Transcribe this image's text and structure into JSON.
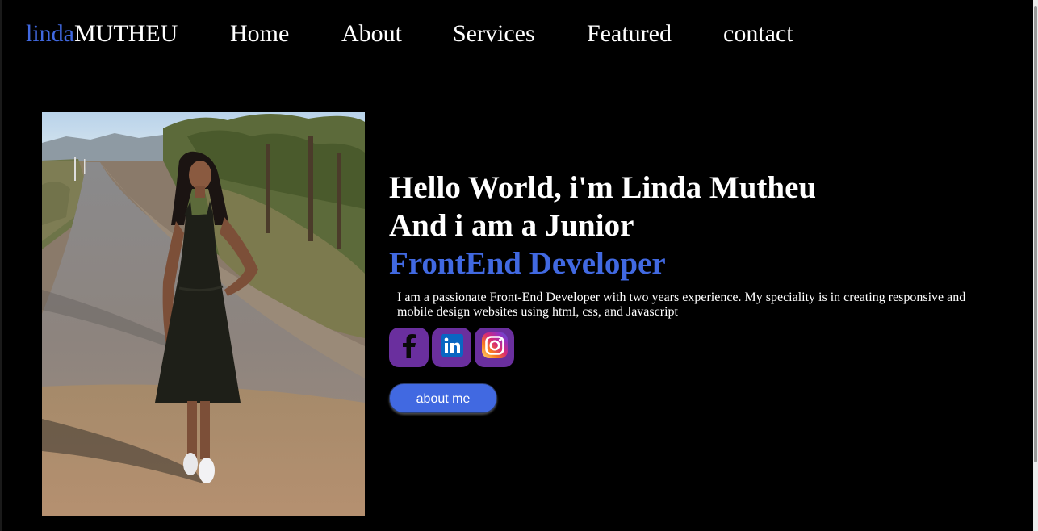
{
  "nav": {
    "logo_accent": "linda",
    "logo_main": "MUTHEU",
    "links": [
      {
        "label": "Home"
      },
      {
        "label": "About"
      },
      {
        "label": "Services"
      },
      {
        "label": "Featured"
      },
      {
        "label": "contact"
      }
    ]
  },
  "hero": {
    "line1": "Hello World, i'm Linda Mutheu",
    "line2": "And i am a Junior",
    "line3": "FrontEnd Developer",
    "bio": "I am a passionate Front-End Developer with two years experience. My speciality is in creating responsive and mobile design websites using html, css, and Javascript",
    "button_label": "about me"
  },
  "social": [
    {
      "icon": "facebook-icon"
    },
    {
      "icon": "linkedin-icon"
    },
    {
      "icon": "instagram-icon"
    }
  ],
  "colors": {
    "background": "#000000",
    "accent": "#4169e1",
    "text": "#ffffff",
    "social_bg": "#6a2f9e"
  }
}
